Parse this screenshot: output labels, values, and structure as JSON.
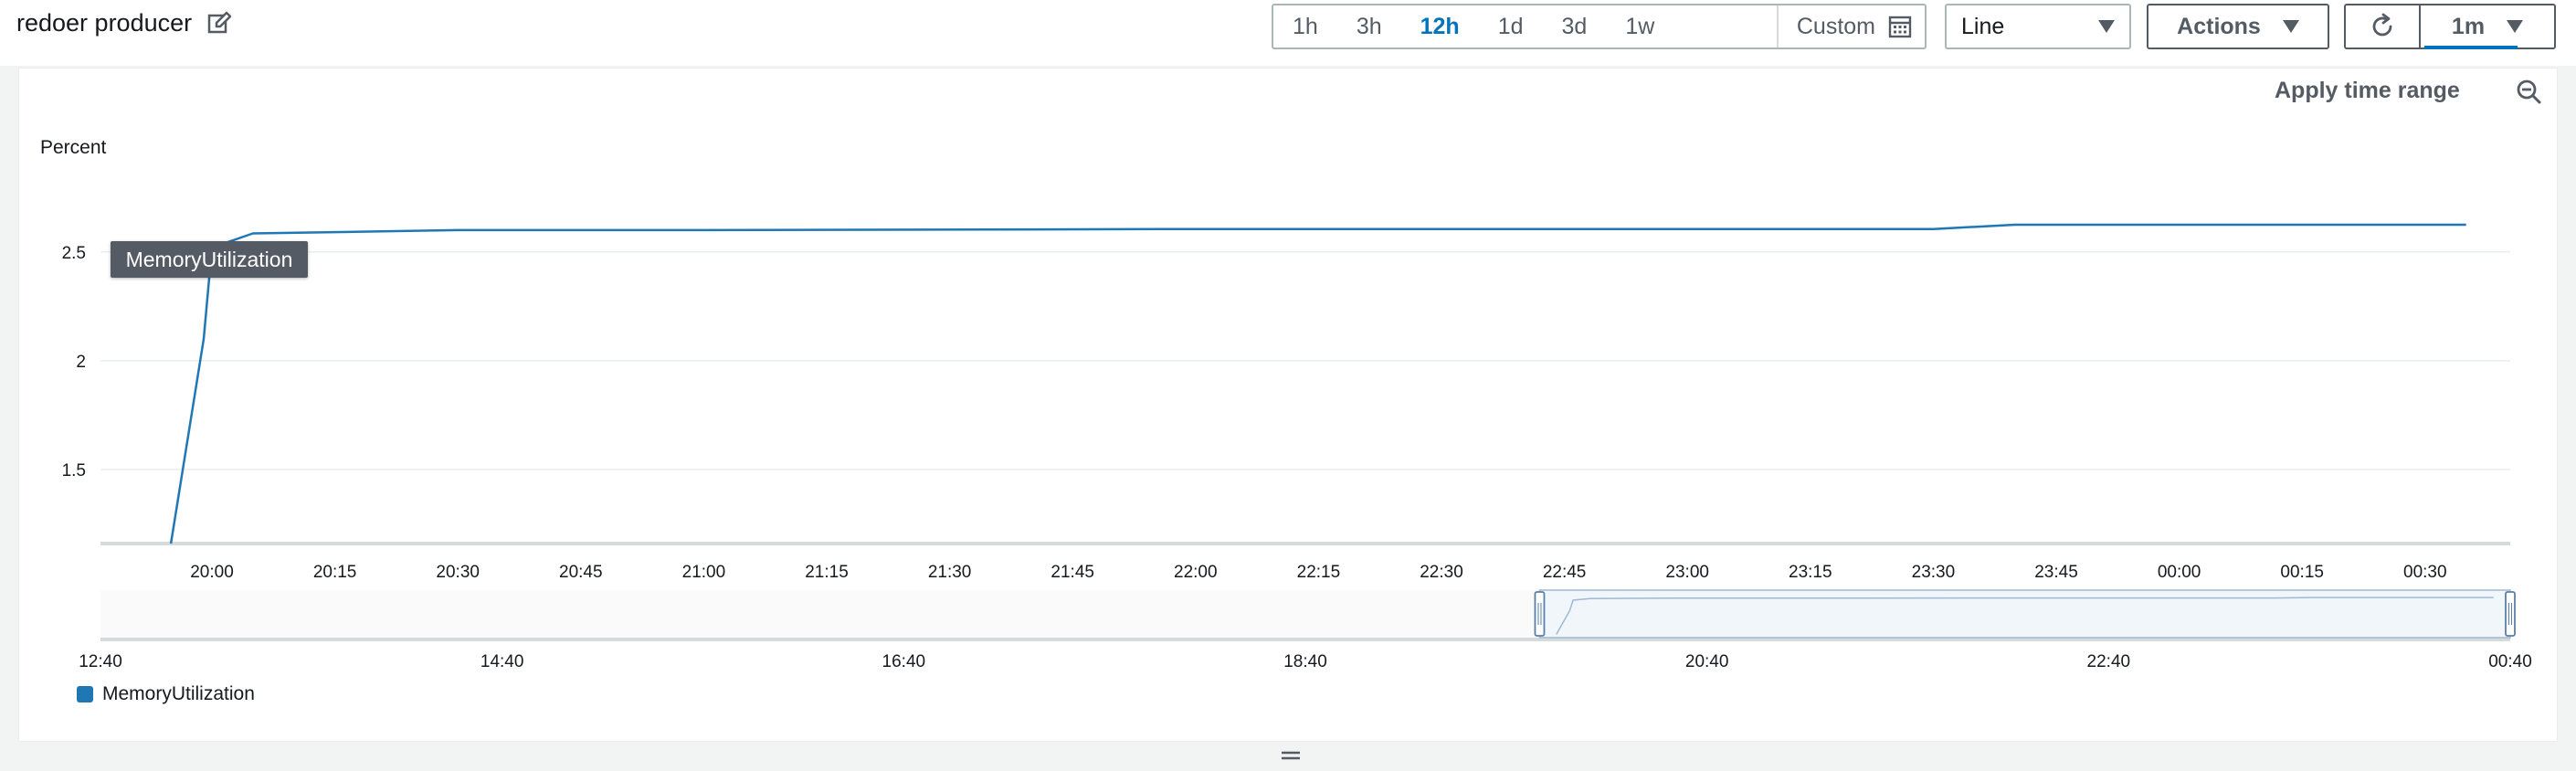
{
  "header": {
    "title": "redoer producer",
    "time_ranges": [
      "1h",
      "3h",
      "12h",
      "1d",
      "3d",
      "1w"
    ],
    "active_range": "12h",
    "custom_label": "Custom",
    "view_select": "Line",
    "actions_label": "Actions",
    "refresh_interval": "1m"
  },
  "panel": {
    "apply_time_range_label": "Apply time range",
    "tooltip": "MemoryUtilization",
    "legend_label": "MemoryUtilization"
  },
  "colors": {
    "series": "#1f77b4",
    "accent": "#0073bb"
  },
  "icons": [
    "edit-icon",
    "calendar-icon",
    "refresh-icon",
    "zoom-out-icon",
    "resize-handle-icon",
    "caret-down-icon"
  ],
  "chart_data": {
    "type": "line",
    "ylabel": "Percent",
    "y_ticks": [
      "2.5",
      "2",
      "1.5"
    ],
    "y_tick_values": [
      2.5,
      2,
      1.5
    ],
    "ylim": [
      1.16,
      2.86
    ],
    "x_ticks": [
      "20:00",
      "20:15",
      "20:30",
      "20:45",
      "21:00",
      "21:15",
      "21:30",
      "21:45",
      "22:00",
      "22:15",
      "22:30",
      "22:45",
      "23:00",
      "23:15",
      "23:30",
      "23:45",
      "00:00",
      "00:15",
      "00:30"
    ],
    "series": [
      {
        "name": "MemoryUtilization",
        "x": [
          "19:55",
          "19:59",
          "20:00",
          "20:05",
          "20:30",
          "21:00",
          "22:00",
          "23:00",
          "23:30",
          "23:40",
          "00:00",
          "00:35"
        ],
        "values": [
          1.16,
          2.1,
          2.52,
          2.585,
          2.6,
          2.6,
          2.605,
          2.605,
          2.605,
          2.625,
          2.625,
          2.625
        ]
      }
    ],
    "navigator": {
      "x_ticks": [
        "12:40",
        "14:40",
        "16:40",
        "18:40",
        "20:40",
        "22:40",
        "00:40"
      ],
      "selection": [
        "19:50",
        "00:40"
      ]
    },
    "grid": true,
    "legend_position": "bottom-left"
  }
}
